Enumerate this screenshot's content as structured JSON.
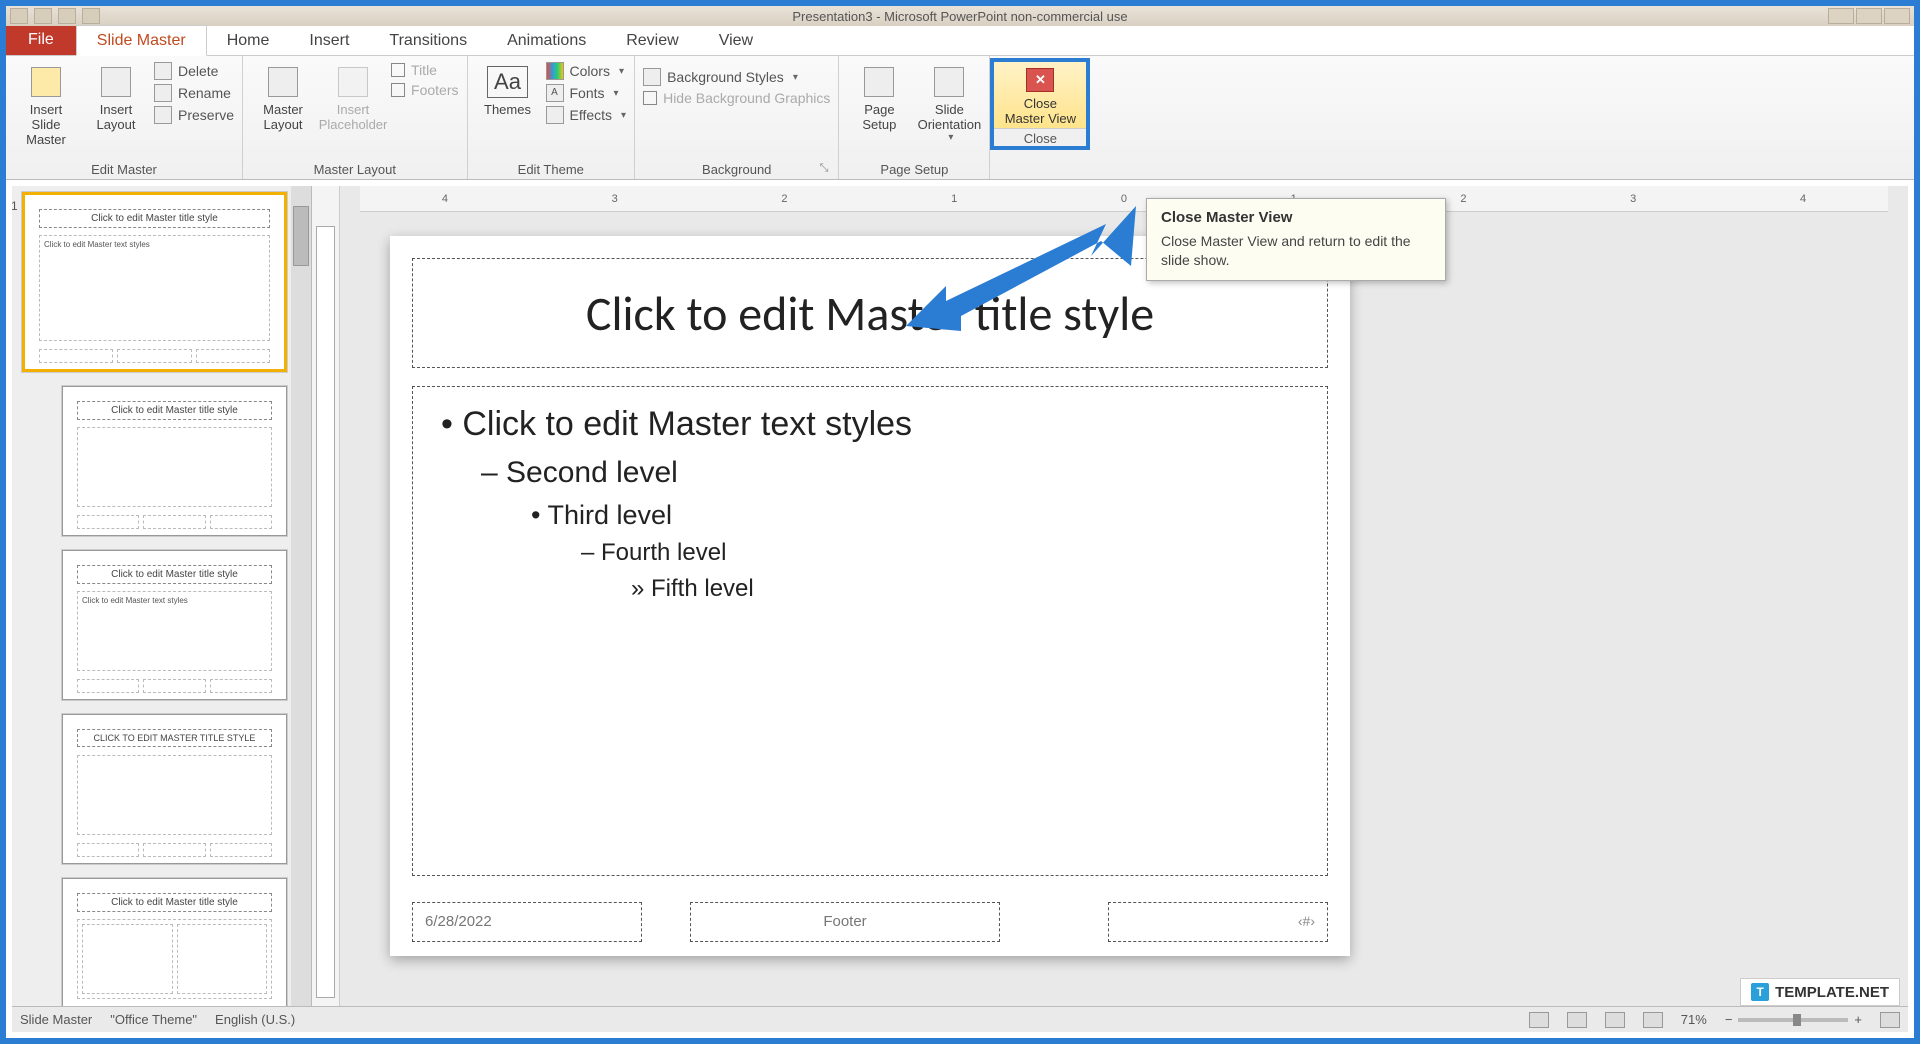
{
  "window": {
    "title": "Presentation3 - Microsoft PowerPoint non-commercial use"
  },
  "tabs": {
    "file": "File",
    "slide_master": "Slide Master",
    "home": "Home",
    "insert": "Insert",
    "transitions": "Transitions",
    "animations": "Animations",
    "review": "Review",
    "view": "View"
  },
  "ribbon": {
    "edit_master": {
      "label": "Edit Master",
      "insert_slide_master": "Insert Slide\nMaster",
      "insert_layout": "Insert\nLayout",
      "delete": "Delete",
      "rename": "Rename",
      "preserve": "Preserve"
    },
    "master_layout": {
      "label": "Master Layout",
      "master_layout_btn": "Master\nLayout",
      "insert_placeholder": "Insert\nPlaceholder",
      "title": "Title",
      "footers": "Footers"
    },
    "edit_theme": {
      "label": "Edit Theme",
      "themes": "Themes",
      "colors": "Colors",
      "fonts": "Fonts",
      "effects": "Effects"
    },
    "background": {
      "label": "Background",
      "background_styles": "Background Styles",
      "hide_bg": "Hide Background Graphics"
    },
    "page_setup": {
      "label": "Page Setup",
      "page_setup_btn": "Page\nSetup",
      "slide_orientation": "Slide\nOrientation"
    },
    "close": {
      "label": "Close",
      "close_master_view": "Close\nMaster View"
    }
  },
  "tooltip": {
    "title": "Close Master View",
    "body": "Close Master View and return to edit the slide show."
  },
  "slide": {
    "title_placeholder": "Click to edit Master title style",
    "body_l1": "Click to edit Master text styles",
    "body_l2": "Second level",
    "body_l3": "Third level",
    "body_l4": "Fourth level",
    "body_l5": "Fifth level",
    "date": "6/28/2022",
    "footer": "Footer",
    "slidenum": "‹#›"
  },
  "ruler_marks": [
    "4",
    "3",
    "2",
    "1",
    "0",
    "1",
    "2",
    "3",
    "4"
  ],
  "thumbs": {
    "master_title": "Click to edit Master title style",
    "child_title": "Click to edit Master title style",
    "child3_title": "CLICK TO EDIT MASTER TITLE STYLE",
    "body_preview": "Click to edit Master text styles"
  },
  "status": {
    "slide_master": "Slide Master",
    "theme": "\"Office Theme\"",
    "lang": "English (U.S.)",
    "zoom": "71%"
  },
  "watermark": "TEMPLATE.NET"
}
